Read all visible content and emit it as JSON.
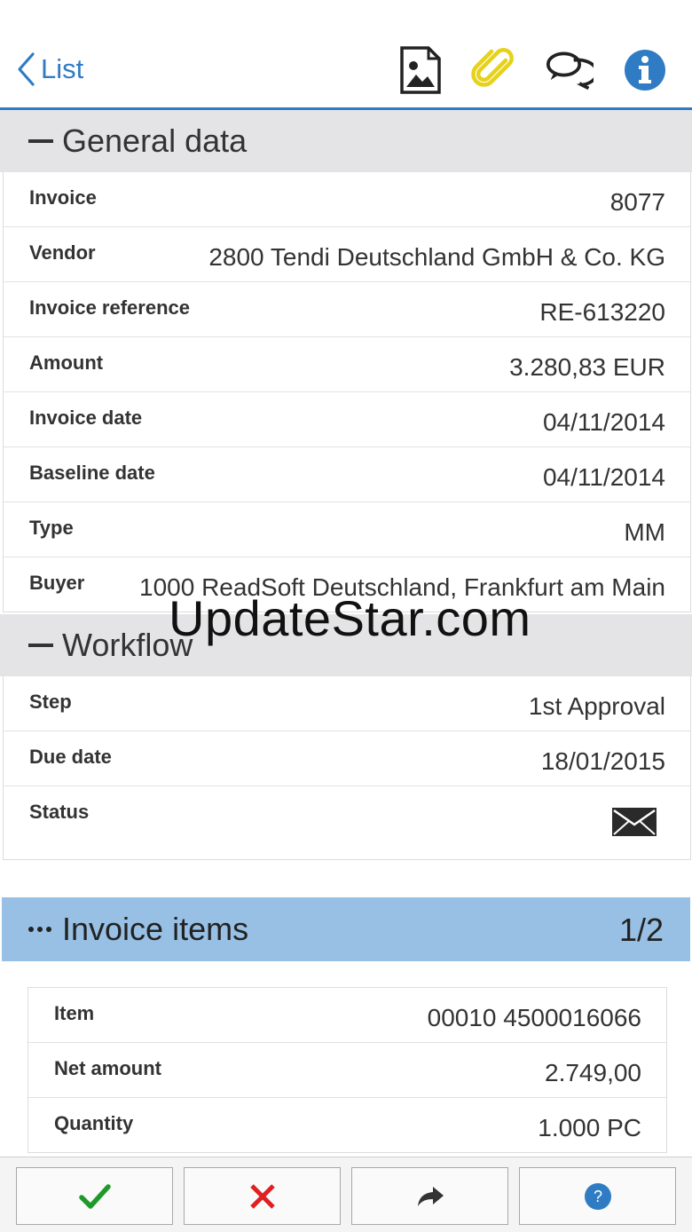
{
  "nav": {
    "back_label": "List",
    "icons": [
      "image-icon",
      "paperclip-icon",
      "comments-icon",
      "info-icon"
    ]
  },
  "general": {
    "title": "General data",
    "rows": [
      {
        "label": "Invoice",
        "value": "8077"
      },
      {
        "label": "Vendor",
        "value": "2800 Tendi Deutschland GmbH & Co. KG"
      },
      {
        "label": "Invoice reference",
        "value": "RE-613220"
      },
      {
        "label": "Amount",
        "value": "3.280,83 EUR"
      },
      {
        "label": "Invoice date",
        "value": "04/11/2014"
      },
      {
        "label": "Baseline date",
        "value": "04/11/2014"
      },
      {
        "label": "Type",
        "value": "MM"
      },
      {
        "label": "Buyer",
        "value": "1000 ReadSoft Deutschland, Frankfurt am Main"
      }
    ]
  },
  "workflow": {
    "title": "Workflow",
    "rows": [
      {
        "label": "Step",
        "value": "1st Approval"
      },
      {
        "label": "Due date",
        "value": "18/01/2015"
      },
      {
        "label": "Status",
        "icon": "envelope-icon"
      }
    ]
  },
  "items": {
    "title": "Invoice items",
    "pager": "1/2",
    "rows": [
      {
        "label": "Item",
        "value": "00010 4500016066"
      },
      {
        "label": "Net amount",
        "value": "2.749,00"
      },
      {
        "label": "Quantity",
        "value": "1.000 PC"
      }
    ]
  },
  "watermark": "UpdateStar.com",
  "toolbar": {
    "buttons": [
      "approve-check-icon",
      "reject-x-icon",
      "forward-arrow-icon",
      "help-icon"
    ]
  },
  "colors": {
    "accent": "#2f7cc4",
    "section_bg": "#e4e4e6",
    "items_header_bg": "#97c0e4",
    "approve": "#1f9a2a",
    "reject": "#e02020",
    "clip": "#e6d21a"
  }
}
